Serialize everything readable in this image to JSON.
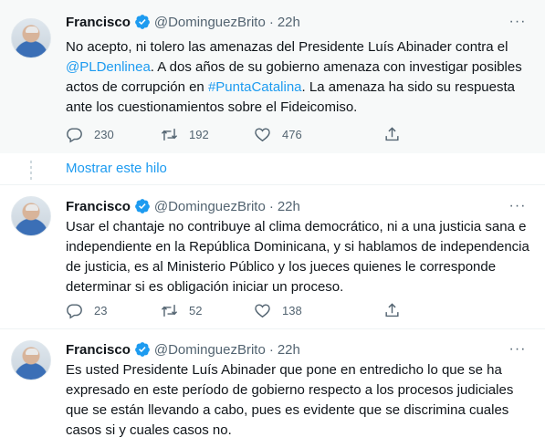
{
  "tweets": [
    {
      "name": "Francisco",
      "handle": "@DominguezBrito",
      "dot": "·",
      "time": "22h",
      "text_parts": [
        "No acepto, ni tolero las amenazas del Presidente Luís Abinader contra el ",
        "@PLDenlinea",
        ". A dos años de su gobierno amenaza con investigar posibles actos de corrupción en ",
        "#PuntaCatalina",
        ". La amenaza ha sido su respuesta ante los cuestionamientos sobre el Fideicomiso."
      ],
      "replies": "230",
      "retweets": "192",
      "likes": "476"
    },
    {
      "name": "Francisco",
      "handle": "@DominguezBrito",
      "dot": "·",
      "time": "22h",
      "text": "Usar el chantaje no contribuye al clima democrático, ni a una justicia sana e independiente en la República Dominicana, y si hablamos de independencia de justicia, es al Ministerio Público y los jueces quienes le corresponde determinar si es obligación iniciar un proceso.",
      "replies": "23",
      "retweets": "52",
      "likes": "138"
    },
    {
      "name": "Francisco",
      "handle": "@DominguezBrito",
      "dot": "·",
      "time": "22h",
      "text": "Es usted Presidente Luís Abinader que pone en entredicho lo que se ha expresado en este período de gobierno respecto a los procesos judiciales que se están llevando a cabo, pues es evidente que se discrimina cuales casos si y cuales casos no."
    }
  ],
  "show_thread": "Mostrar este hilo",
  "more_glyph": "···",
  "colors": {
    "accent": "#1d9bf0",
    "secondary_text": "#536471",
    "highlight_bg": "#f7f9f9"
  },
  "icons": [
    "verified-badge-icon",
    "reply-icon",
    "retweet-icon",
    "like-icon",
    "share-icon",
    "more-icon"
  ]
}
